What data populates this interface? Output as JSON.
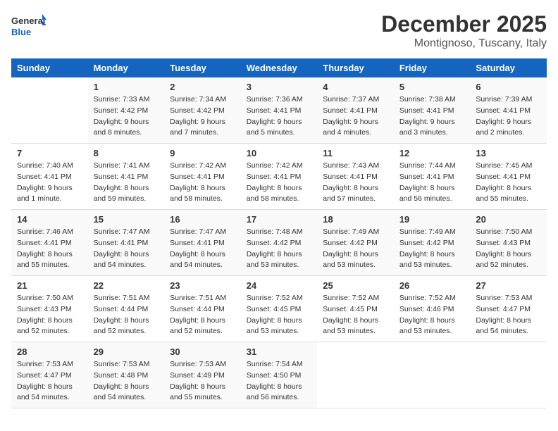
{
  "logo": {
    "line1": "General",
    "line2": "Blue"
  },
  "title": "December 2025",
  "subtitle": "Montignoso, Tuscany, Italy",
  "days_header": [
    "Sunday",
    "Monday",
    "Tuesday",
    "Wednesday",
    "Thursday",
    "Friday",
    "Saturday"
  ],
  "weeks": [
    [
      {
        "num": "",
        "sunrise": "",
        "sunset": "",
        "daylight": ""
      },
      {
        "num": "1",
        "sunrise": "Sunrise: 7:33 AM",
        "sunset": "Sunset: 4:42 PM",
        "daylight": "Daylight: 9 hours and 8 minutes."
      },
      {
        "num": "2",
        "sunrise": "Sunrise: 7:34 AM",
        "sunset": "Sunset: 4:42 PM",
        "daylight": "Daylight: 9 hours and 7 minutes."
      },
      {
        "num": "3",
        "sunrise": "Sunrise: 7:36 AM",
        "sunset": "Sunset: 4:41 PM",
        "daylight": "Daylight: 9 hours and 5 minutes."
      },
      {
        "num": "4",
        "sunrise": "Sunrise: 7:37 AM",
        "sunset": "Sunset: 4:41 PM",
        "daylight": "Daylight: 9 hours and 4 minutes."
      },
      {
        "num": "5",
        "sunrise": "Sunrise: 7:38 AM",
        "sunset": "Sunset: 4:41 PM",
        "daylight": "Daylight: 9 hours and 3 minutes."
      },
      {
        "num": "6",
        "sunrise": "Sunrise: 7:39 AM",
        "sunset": "Sunset: 4:41 PM",
        "daylight": "Daylight: 9 hours and 2 minutes."
      }
    ],
    [
      {
        "num": "7",
        "sunrise": "Sunrise: 7:40 AM",
        "sunset": "Sunset: 4:41 PM",
        "daylight": "Daylight: 9 hours and 1 minute."
      },
      {
        "num": "8",
        "sunrise": "Sunrise: 7:41 AM",
        "sunset": "Sunset: 4:41 PM",
        "daylight": "Daylight: 8 hours and 59 minutes."
      },
      {
        "num": "9",
        "sunrise": "Sunrise: 7:42 AM",
        "sunset": "Sunset: 4:41 PM",
        "daylight": "Daylight: 8 hours and 58 minutes."
      },
      {
        "num": "10",
        "sunrise": "Sunrise: 7:42 AM",
        "sunset": "Sunset: 4:41 PM",
        "daylight": "Daylight: 8 hours and 58 minutes."
      },
      {
        "num": "11",
        "sunrise": "Sunrise: 7:43 AM",
        "sunset": "Sunset: 4:41 PM",
        "daylight": "Daylight: 8 hours and 57 minutes."
      },
      {
        "num": "12",
        "sunrise": "Sunrise: 7:44 AM",
        "sunset": "Sunset: 4:41 PM",
        "daylight": "Daylight: 8 hours and 56 minutes."
      },
      {
        "num": "13",
        "sunrise": "Sunrise: 7:45 AM",
        "sunset": "Sunset: 4:41 PM",
        "daylight": "Daylight: 8 hours and 55 minutes."
      }
    ],
    [
      {
        "num": "14",
        "sunrise": "Sunrise: 7:46 AM",
        "sunset": "Sunset: 4:41 PM",
        "daylight": "Daylight: 8 hours and 55 minutes."
      },
      {
        "num": "15",
        "sunrise": "Sunrise: 7:47 AM",
        "sunset": "Sunset: 4:41 PM",
        "daylight": "Daylight: 8 hours and 54 minutes."
      },
      {
        "num": "16",
        "sunrise": "Sunrise: 7:47 AM",
        "sunset": "Sunset: 4:41 PM",
        "daylight": "Daylight: 8 hours and 54 minutes."
      },
      {
        "num": "17",
        "sunrise": "Sunrise: 7:48 AM",
        "sunset": "Sunset: 4:42 PM",
        "daylight": "Daylight: 8 hours and 53 minutes."
      },
      {
        "num": "18",
        "sunrise": "Sunrise: 7:49 AM",
        "sunset": "Sunset: 4:42 PM",
        "daylight": "Daylight: 8 hours and 53 minutes."
      },
      {
        "num": "19",
        "sunrise": "Sunrise: 7:49 AM",
        "sunset": "Sunset: 4:42 PM",
        "daylight": "Daylight: 8 hours and 53 minutes."
      },
      {
        "num": "20",
        "sunrise": "Sunrise: 7:50 AM",
        "sunset": "Sunset: 4:43 PM",
        "daylight": "Daylight: 8 hours and 52 minutes."
      }
    ],
    [
      {
        "num": "21",
        "sunrise": "Sunrise: 7:50 AM",
        "sunset": "Sunset: 4:43 PM",
        "daylight": "Daylight: 8 hours and 52 minutes."
      },
      {
        "num": "22",
        "sunrise": "Sunrise: 7:51 AM",
        "sunset": "Sunset: 4:44 PM",
        "daylight": "Daylight: 8 hours and 52 minutes."
      },
      {
        "num": "23",
        "sunrise": "Sunrise: 7:51 AM",
        "sunset": "Sunset: 4:44 PM",
        "daylight": "Daylight: 8 hours and 52 minutes."
      },
      {
        "num": "24",
        "sunrise": "Sunrise: 7:52 AM",
        "sunset": "Sunset: 4:45 PM",
        "daylight": "Daylight: 8 hours and 53 minutes."
      },
      {
        "num": "25",
        "sunrise": "Sunrise: 7:52 AM",
        "sunset": "Sunset: 4:45 PM",
        "daylight": "Daylight: 8 hours and 53 minutes."
      },
      {
        "num": "26",
        "sunrise": "Sunrise: 7:52 AM",
        "sunset": "Sunset: 4:46 PM",
        "daylight": "Daylight: 8 hours and 53 minutes."
      },
      {
        "num": "27",
        "sunrise": "Sunrise: 7:53 AM",
        "sunset": "Sunset: 4:47 PM",
        "daylight": "Daylight: 8 hours and 54 minutes."
      }
    ],
    [
      {
        "num": "28",
        "sunrise": "Sunrise: 7:53 AM",
        "sunset": "Sunset: 4:47 PM",
        "daylight": "Daylight: 8 hours and 54 minutes."
      },
      {
        "num": "29",
        "sunrise": "Sunrise: 7:53 AM",
        "sunset": "Sunset: 4:48 PM",
        "daylight": "Daylight: 8 hours and 54 minutes."
      },
      {
        "num": "30",
        "sunrise": "Sunrise: 7:53 AM",
        "sunset": "Sunset: 4:49 PM",
        "daylight": "Daylight: 8 hours and 55 minutes."
      },
      {
        "num": "31",
        "sunrise": "Sunrise: 7:54 AM",
        "sunset": "Sunset: 4:50 PM",
        "daylight": "Daylight: 8 hours and 56 minutes."
      },
      {
        "num": "",
        "sunrise": "",
        "sunset": "",
        "daylight": ""
      },
      {
        "num": "",
        "sunrise": "",
        "sunset": "",
        "daylight": ""
      },
      {
        "num": "",
        "sunrise": "",
        "sunset": "",
        "daylight": ""
      }
    ]
  ]
}
